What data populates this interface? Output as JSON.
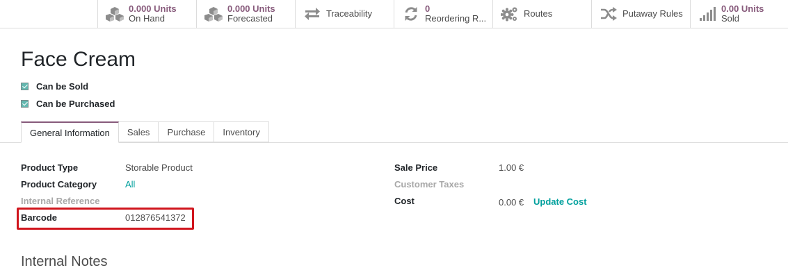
{
  "smart_buttons": [
    {
      "icon": "cubes-icon",
      "value": "0.000 Units",
      "label": "On Hand"
    },
    {
      "icon": "cubes-icon",
      "value": "0.000 Units",
      "label": "Forecasted"
    },
    {
      "icon": "exchange-arrows-icon",
      "value": "",
      "label": "Traceability"
    },
    {
      "icon": "refresh-icon",
      "value": "0",
      "label": "Reordering R..."
    },
    {
      "icon": "gears-icon",
      "value": "",
      "label": "Routes"
    },
    {
      "icon": "random-icon",
      "value": "",
      "label": "Putaway Rules"
    },
    {
      "icon": "signal-bars-icon",
      "value": "0.00 Units",
      "label": "Sold"
    }
  ],
  "product": {
    "name": "Face Cream",
    "can_be_sold": "Can be Sold",
    "can_be_purchased": "Can be Purchased"
  },
  "tabs": [
    "General Information",
    "Sales",
    "Purchase",
    "Inventory"
  ],
  "left_fields": {
    "product_type_label": "Product Type",
    "product_type_value": "Storable Product",
    "product_category_label": "Product Category",
    "product_category_value": "All",
    "internal_reference_label": "Internal Reference",
    "barcode_label": "Barcode",
    "barcode_value": "012876541372"
  },
  "right_fields": {
    "sale_price_label": "Sale Price",
    "sale_price_value": "1.00 €",
    "customer_taxes_label": "Customer Taxes",
    "cost_label": "Cost",
    "cost_value": "0.00 €",
    "update_cost_label": "Update Cost"
  },
  "internal_notes_title": "Internal Notes",
  "colors": {
    "accent": "#875a7b",
    "link": "#00a09d",
    "highlight": "#d0151d",
    "checkbox": "#63b8b0"
  }
}
